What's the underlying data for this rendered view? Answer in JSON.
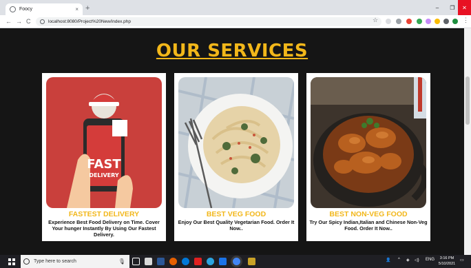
{
  "browser": {
    "tab_title": "Foocy",
    "tab_close": "×",
    "new_tab": "+",
    "url": "localhost:8080/Project%20New/index.php",
    "window_min": "–",
    "window_max": "❐",
    "window_close": "✕",
    "nav_back": "←",
    "nav_forward": "→",
    "nav_reload": "C",
    "star": "☆",
    "menu": "⋮"
  },
  "page": {
    "heading": "OUR SERVICES",
    "cards": [
      {
        "title": "FASTEST DELIVERY",
        "description": "Experience Best Food Delivery on Time. Cover Your hunger Instantly By Using Our Fastest Delivery.",
        "image_text_1": "FAST",
        "image_text_2": "DELIVERY"
      },
      {
        "title": "BEST VEG FOOD",
        "description": "Enjoy Our Best Quality Vegetarian Food. Order It Now.."
      },
      {
        "title": "BEST NON-VEG FOOD",
        "description": "Try Our Spicy Indian,Italian and Chinese Non-Veg Food. Order It Now.."
      }
    ]
  },
  "taskbar": {
    "search_placeholder": "Type here to search",
    "tray_lang": "ENG",
    "clock_time": "3:16 PM",
    "clock_date": "5/10/2021"
  },
  "colors": {
    "accent": "#f2b71a",
    "page_bg": "#151515",
    "taskbar_bg": "#1f1f24"
  }
}
